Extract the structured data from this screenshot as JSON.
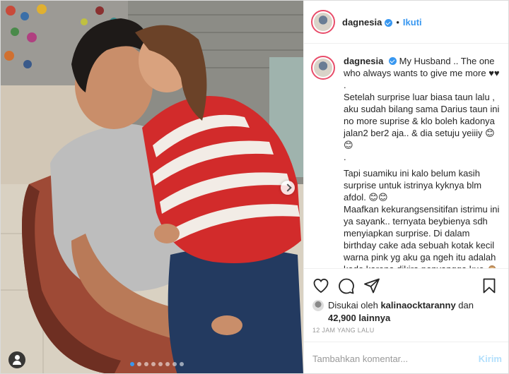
{
  "post": {
    "username": "dagnesia",
    "verified": true,
    "separator": "•",
    "follow_label": "Ikuti",
    "colors": {
      "accent": "#3897f0",
      "story_ring": "#e84d6a"
    }
  },
  "caption": {
    "username": "dagnesia",
    "lines": [
      "My Husband .. The one who always wants to give me more ♥♥",
      ".",
      "Setelah surprise luar biasa taun lalu , aku sudah bilang sama Darius taun ini no more suprise & klo boleh kadonya jalan2 ber2 aja.. & dia setuju yeiiiy 😊😊",
      ".",
      "Tapi suamiku ini kalo belum kasih surprise untuk istrinya kyknya blm afdol. 😊😊",
      "Maafkan kekurangsensitifan istrimu ini ya sayank.. ternyata beybienya sdh menyiapkan surprise. Di dalam birthday cake ada sebuah kotak kecil warna pink yg aku ga ngeh itu adalah kado karena dikira penyangga kue 🙈🙈🤦‍♀️🙈"
    ]
  },
  "actions": {
    "like_icon": "heart-icon",
    "comment_icon": "comment-icon",
    "share_icon": "paper-plane-icon",
    "save_icon": "bookmark-icon"
  },
  "likes": {
    "prefix": "Disukai oleh",
    "user": "kalinaocktaranny",
    "conj": "dan",
    "count": "42,900 lainnya"
  },
  "timestamp": "12 JAM YANG LALU",
  "comment_box": {
    "placeholder": "Tambahkan komentar...",
    "post_label": "Kirim"
  },
  "carousel": {
    "total": 8,
    "active_index": 0
  }
}
